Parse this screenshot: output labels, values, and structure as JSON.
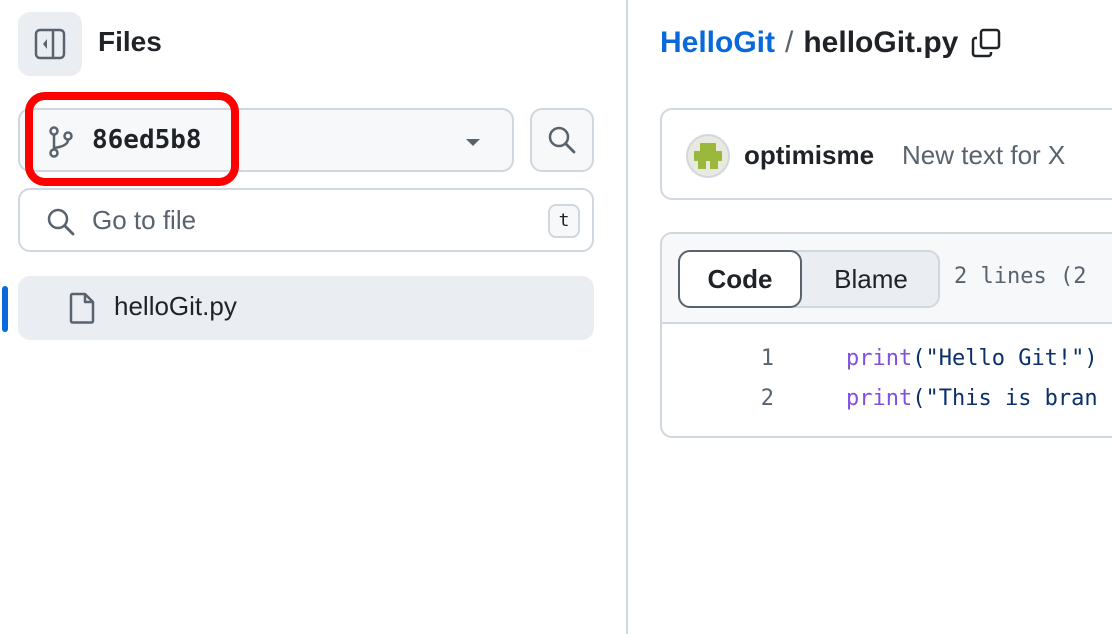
{
  "sidebar": {
    "title": "Files",
    "branch": {
      "name": "86ed5b8"
    },
    "go_to_file": {
      "placeholder": "Go to file",
      "shortcut": "t"
    },
    "tree": [
      {
        "label": "helloGit.py",
        "icon": "file-icon",
        "selected": true
      }
    ]
  },
  "main": {
    "breadcrumb": {
      "repo": "HelloGit",
      "separator": "/",
      "file": "helloGit.py"
    },
    "commit": {
      "author": "optimisme",
      "message": "New text for X"
    },
    "viewer": {
      "tabs": [
        {
          "label": "Code",
          "active": true
        },
        {
          "label": "Blame",
          "active": false
        }
      ],
      "lines_info": "2 lines (2",
      "lines": [
        {
          "number": "1",
          "keyword": "print",
          "rest": "(\"Hello Git!\")"
        },
        {
          "number": "2",
          "keyword": "print",
          "rest": "(\"This is bran"
        }
      ]
    }
  },
  "colors": {
    "accent": "#0969da",
    "highlight_box": "#ff0000",
    "keyword": "#8250df",
    "string": "#0a3069",
    "muted": "#59636e",
    "border": "#d0d7de"
  }
}
